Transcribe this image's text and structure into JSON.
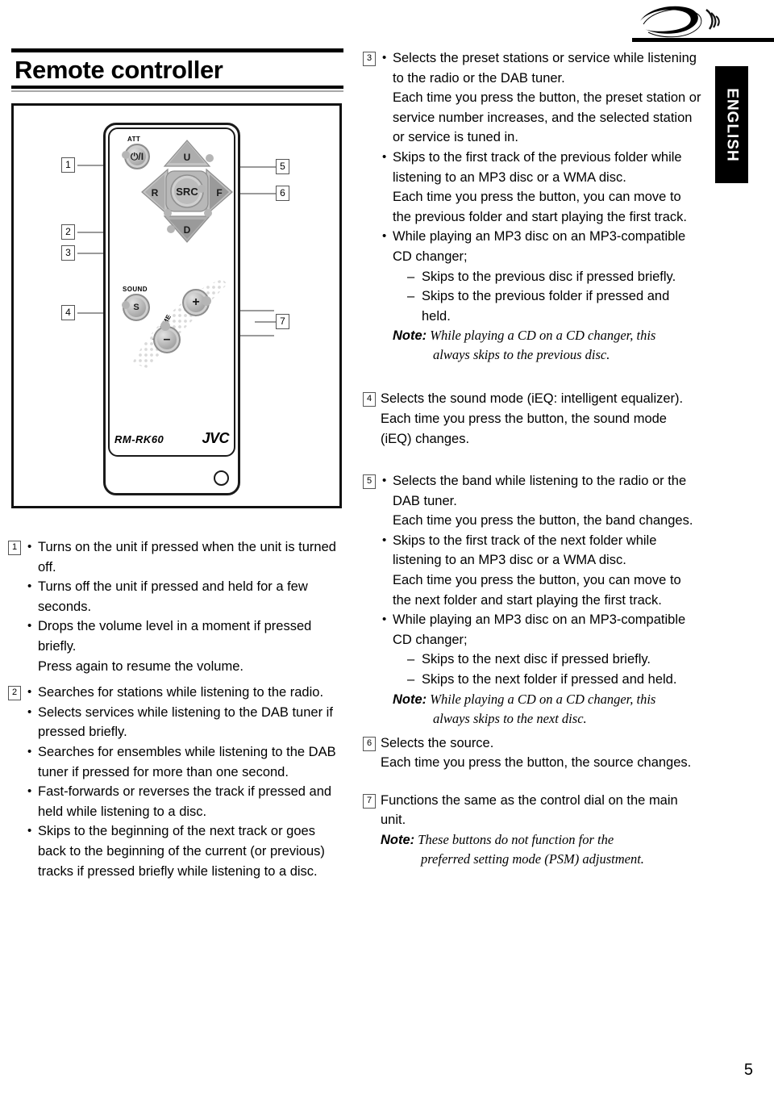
{
  "header": {
    "logo_icon": "swoosh-wave-logo",
    "language_tab": "ENGLISH"
  },
  "heading": {
    "title": "Remote controller"
  },
  "figure": {
    "name": "remote-controller-diagram",
    "model_label": "RM-RK60",
    "brand_label": "JVC",
    "button_labels": {
      "att": "ATT",
      "power": "⏻/I",
      "up": "U",
      "down": "D",
      "rew": "R",
      "ff": "F",
      "src": "SRC",
      "sound": "SOUND",
      "sound_btn": "S",
      "vol_up": "+",
      "vol_down": "–",
      "volume": "VOLUME"
    },
    "callouts": [
      "1",
      "2",
      "3",
      "4",
      "5",
      "6",
      "7"
    ]
  },
  "items_left": [
    {
      "number": "1",
      "bullets": [
        "Turns on the unit if pressed when the unit is turned off.",
        "Turns off the unit if pressed and held for a few seconds.",
        "Drops the volume level in a moment if pressed briefly."
      ],
      "plain_lines": [
        "Press again to resume the volume."
      ]
    },
    {
      "number": "2",
      "bullets": [
        "Searches for stations while listening to the radio.",
        "Selects services while listening to the DAB tuner if pressed briefly.",
        "Searches for ensembles while listening to the DAB tuner if pressed for more than one second.",
        "Fast-forwards or reverses the track if pressed and held while listening to a disc.",
        "Skips to the beginning of the next track or goes back to the beginning of the current (or previous) tracks if pressed briefly while listening to a disc."
      ]
    }
  ],
  "items_right": [
    {
      "number": "3",
      "bullet_1": "Selects the preset stations or service while listening to the radio or the DAB tuner.",
      "bullet_1_cont": "Each time you press the button, the preset station or service number increases, and the selected station or service is tuned in.",
      "bullet_2": "Skips to the first track of the previous folder while listening to an MP3 disc or a WMA disc.",
      "bullet_2_cont": "Each time you press the button, you can move to the previous folder and start playing the first track.",
      "bullet_3": "While playing an MP3 disc on an MP3-compatible CD changer;",
      "dashes": [
        "Skips to the previous disc if pressed briefly.",
        "Skips to the previous folder if pressed and held."
      ],
      "note_label": "Note:",
      "note_text": "While playing a CD on a CD changer, this",
      "note_text2": "always skips to the previous disc."
    },
    {
      "number": "4",
      "line_1": "Selects the sound mode (iEQ: intelligent equalizer).",
      "line_2": "Each time you press the button, the sound mode (iEQ) changes."
    },
    {
      "number": "5",
      "bullet_1": "Selects the band while listening to the radio or the DAB tuner.",
      "bullet_1_cont": "Each time you press the button, the band changes.",
      "bullet_2": "Skips to the first track of the next folder while listening to an MP3 disc or a WMA disc.",
      "bullet_2_cont": "Each time you press the button, you can move to the next folder and start playing the first track.",
      "bullet_3": "While playing an MP3 disc on an MP3-compatible CD changer;",
      "dashes": [
        "Skips to the next disc if pressed briefly.",
        "Skips to the next folder if pressed and held."
      ],
      "note_label": "Note:",
      "note_text": "While playing a CD on a CD changer, this",
      "note_text2": "always skips to the next disc."
    },
    {
      "number": "6",
      "line_1": "Selects the source.",
      "line_2": "Each time you press the button, the source changes."
    },
    {
      "number": "7",
      "line_1": "Functions the same as the control dial on the main unit.",
      "note_label": "Note:",
      "note_text": "These buttons do not function for the",
      "note_text2": "preferred setting mode (PSM) adjustment."
    }
  ],
  "footer": {
    "page_number": "5"
  }
}
